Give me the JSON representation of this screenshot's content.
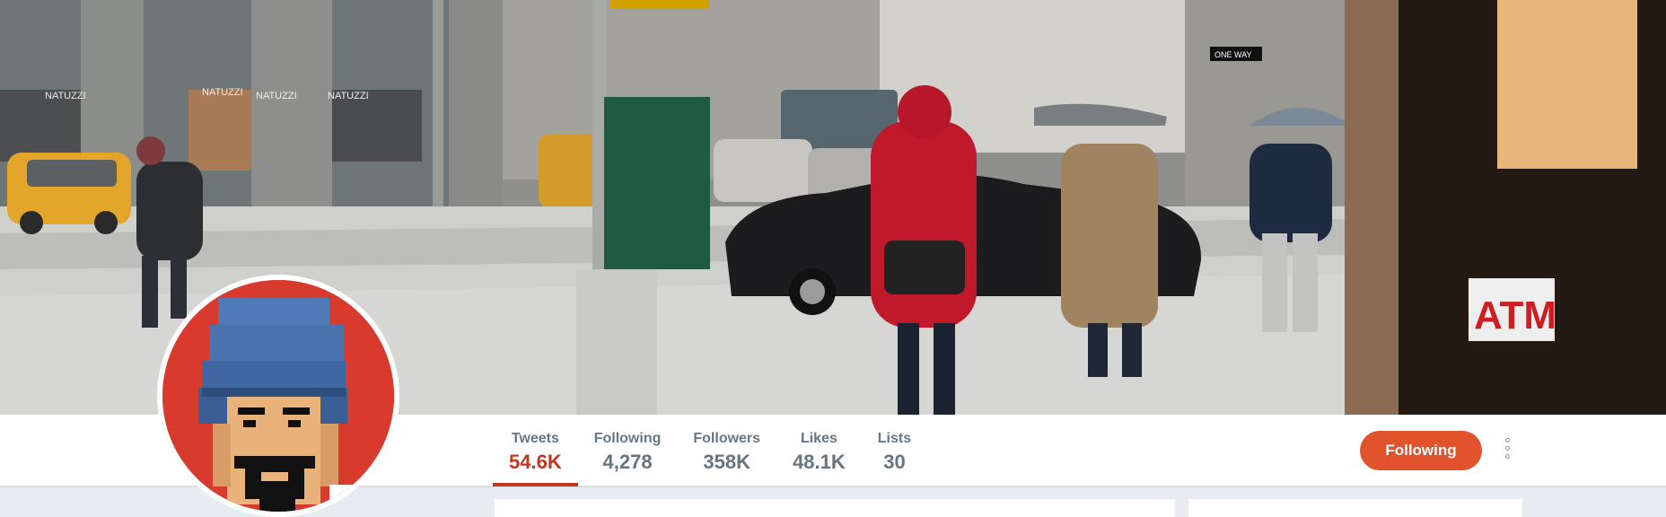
{
  "banner": {
    "storefront_sign_1": "NATUZZI",
    "storefront_sign_2": "NATUZZI",
    "storefront_sign_3": "NATUZZI",
    "storefront_sign_4": "NATUZZI",
    "street_sign": "ONE WAY",
    "atm_sign": "ATM"
  },
  "profile_nav": {
    "stats": [
      {
        "label": "Tweets",
        "value": "54.6K"
      },
      {
        "label": "Following",
        "value": "4,278"
      },
      {
        "label": "Followers",
        "value": "358K"
      },
      {
        "label": "Likes",
        "value": "48.1K"
      },
      {
        "label": "Lists",
        "value": "30"
      }
    ],
    "follow_button": "Following"
  },
  "colors": {
    "accent": "#c2381f",
    "follow_button": "#e0532d",
    "stat_label": "#657786",
    "page_background": "#e6ecf0"
  },
  "icons": {
    "more": "vertical-dots-icon"
  }
}
